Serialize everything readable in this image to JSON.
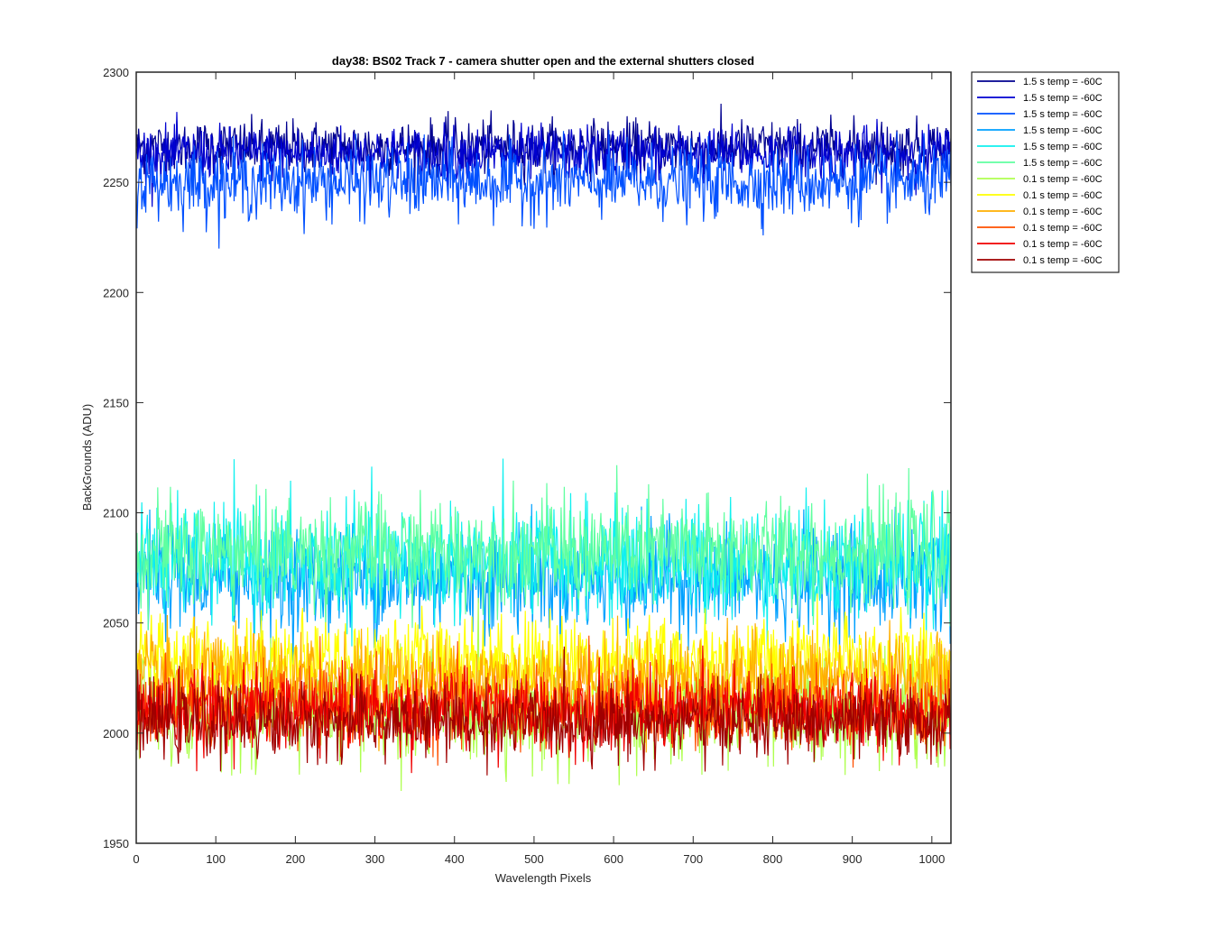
{
  "chart_data": {
    "type": "line",
    "title": "day38: BS02  Track 7 - camera shutter open and the external shutters closed",
    "xlabel": "Wavelength Pixels",
    "ylabel": "BackGrounds (ADU)",
    "xlim": [
      0,
      1024
    ],
    "ylim": [
      1950,
      2300
    ],
    "xticks": [
      0,
      100,
      200,
      300,
      400,
      500,
      600,
      700,
      800,
      900,
      1000
    ],
    "yticks": [
      1950,
      2000,
      2050,
      2100,
      2150,
      2200,
      2250,
      2300
    ],
    "grid": false,
    "legend_position": "outside-top-right",
    "series": [
      {
        "name": "1.5 s temp = -60C",
        "color": "#00008f",
        "mean": 2266,
        "noise": 6
      },
      {
        "name": "1.5 s temp = -60C",
        "color": "#0000d0",
        "mean": 2263,
        "noise": 6
      },
      {
        "name": "1.5 s temp = -60C",
        "color": "#0050ff",
        "mean": 2250,
        "noise": 8
      },
      {
        "name": "1.5 s temp = -60C",
        "color": "#00a0ff",
        "mean": 2070,
        "noise": 12
      },
      {
        "name": "1.5 s temp = -60C",
        "color": "#10f0ef",
        "mean": 2078,
        "noise": 13
      },
      {
        "name": "1.5 s temp = -60C",
        "color": "#60ffa0",
        "mean": 2082,
        "noise": 12
      },
      {
        "name": "0.1 s temp = -60C",
        "color": "#afff50",
        "mean": 2010,
        "noise": 12
      },
      {
        "name": "0.1 s temp = -60C",
        "color": "#ffff00",
        "mean": 2033,
        "noise": 10
      },
      {
        "name": "0.1 s temp = -60C",
        "color": "#ffaf00",
        "mean": 2025,
        "noise": 10
      },
      {
        "name": "0.1 s temp = -60C",
        "color": "#ff5000",
        "mean": 2012,
        "noise": 9
      },
      {
        "name": "0.1 s temp = -60C",
        "color": "#f00000",
        "mean": 2010,
        "noise": 9
      },
      {
        "name": "0.1 s temp = -60C",
        "color": "#a00000",
        "mean": 2005,
        "noise": 8
      }
    ]
  }
}
